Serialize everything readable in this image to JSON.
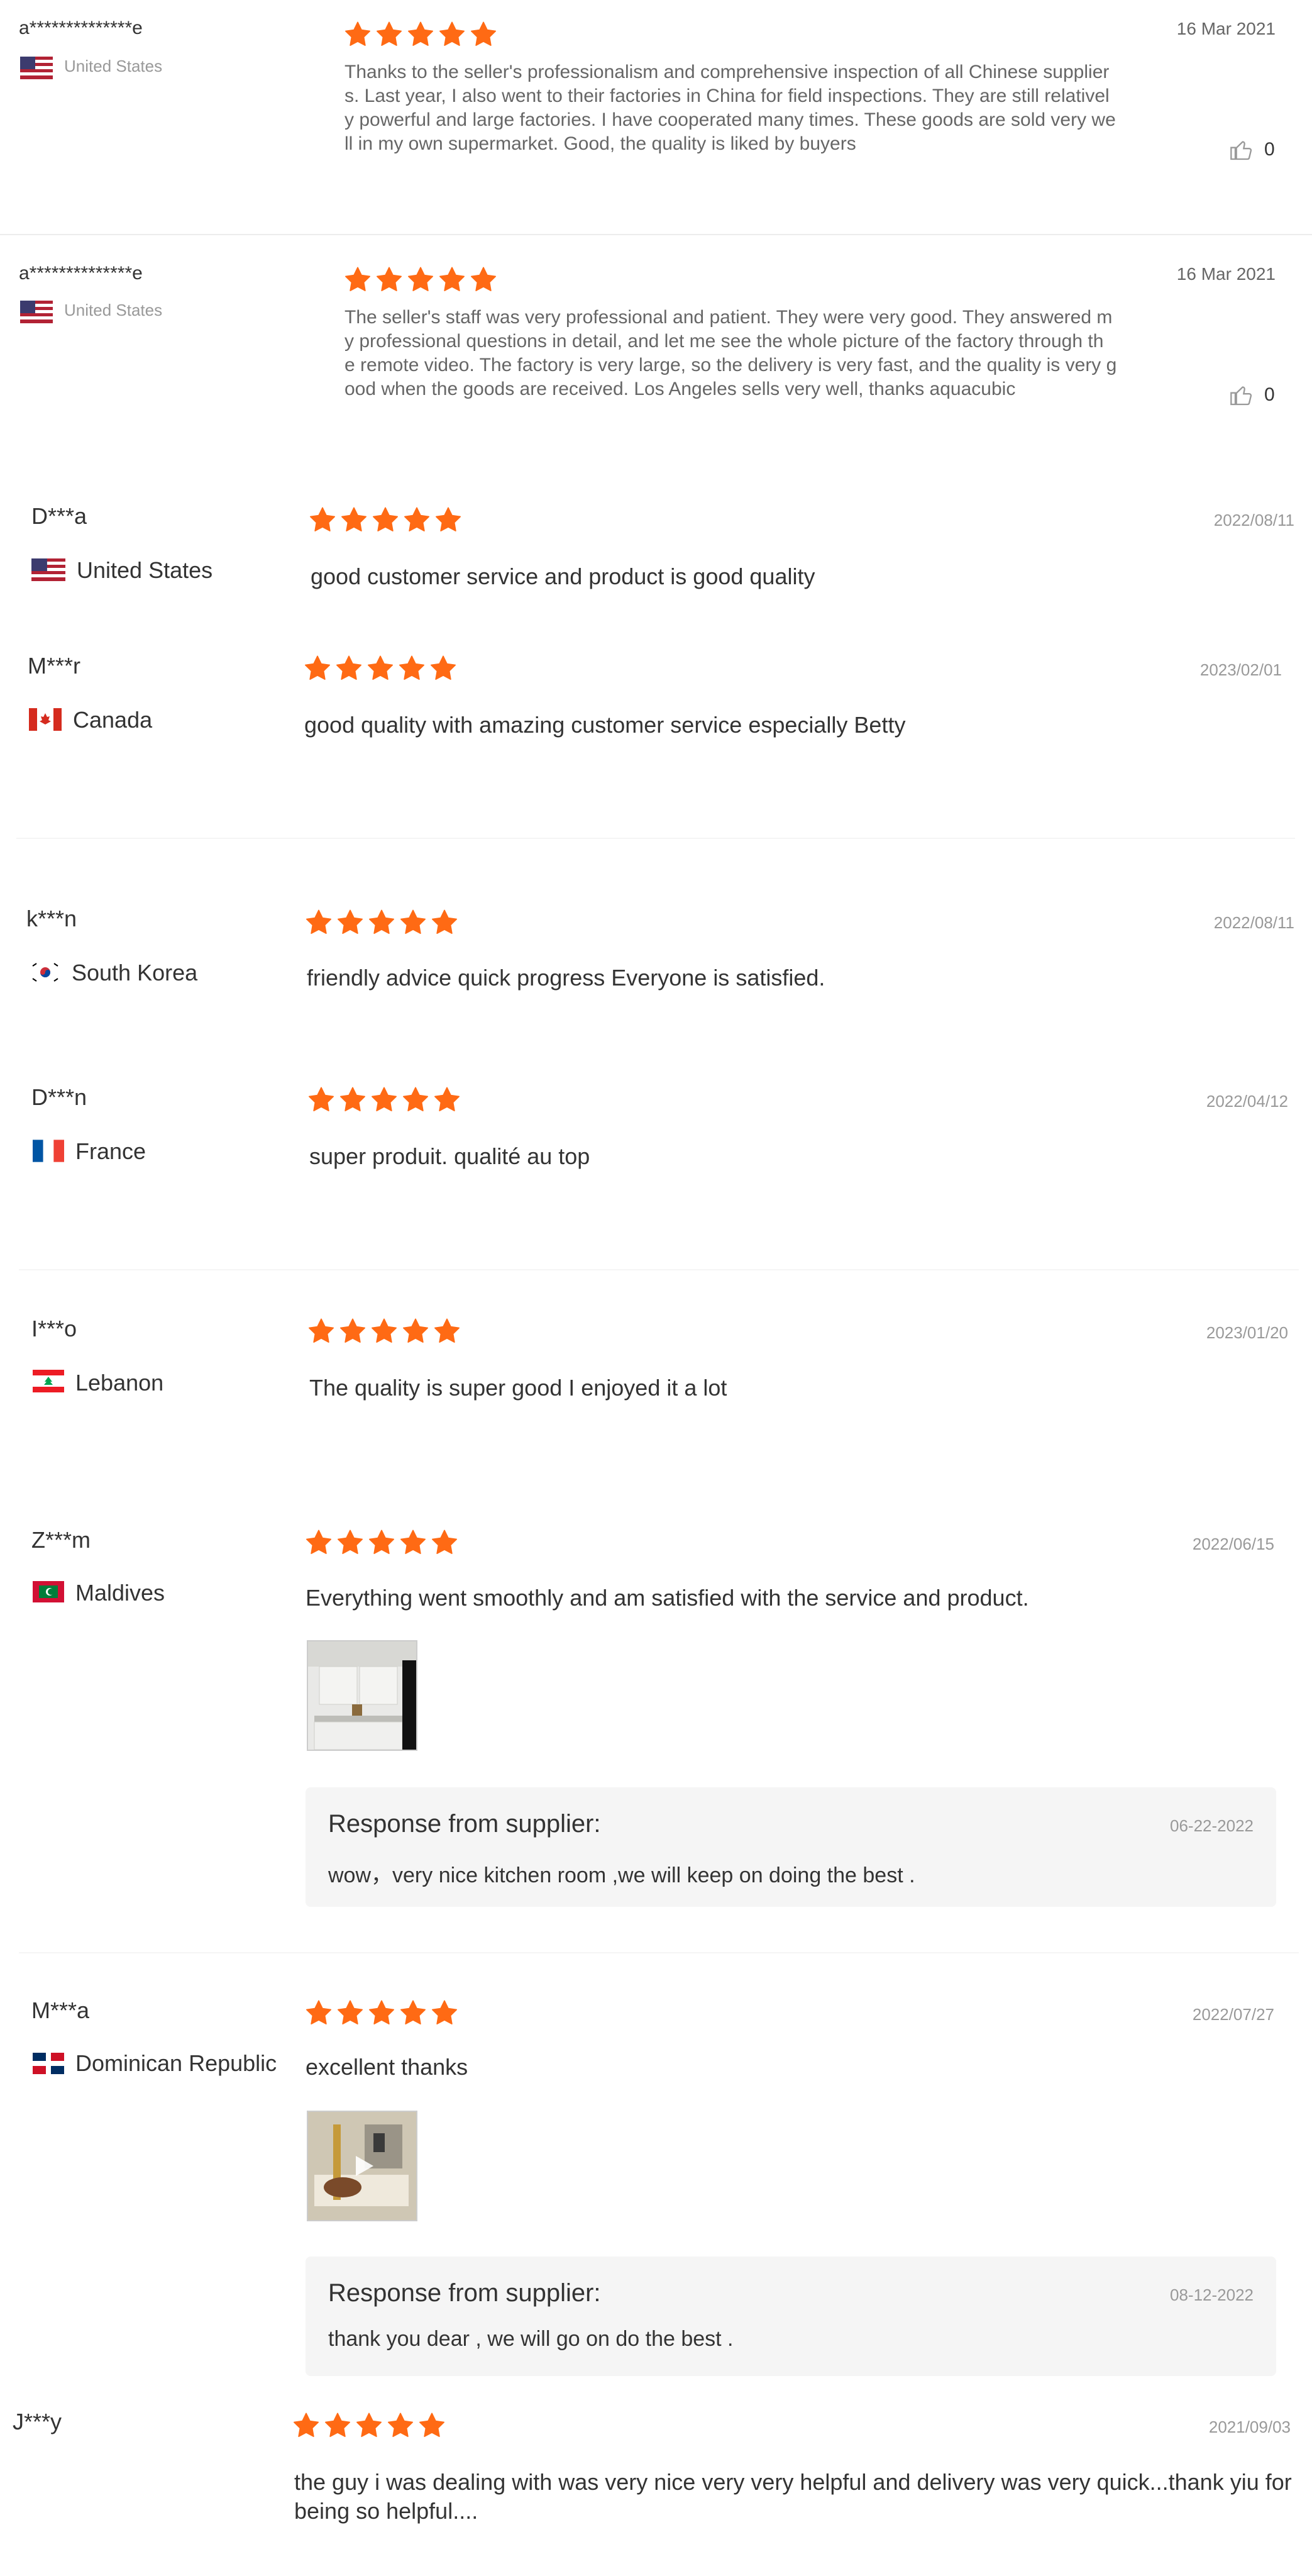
{
  "colors": {
    "star": "#ff6a14",
    "text": "#333333",
    "muted": "#999999",
    "panel": "#f5f5f5"
  },
  "reviews": [
    {
      "name": "a**************e",
      "country": "United States",
      "flag": "us-flag-icon",
      "rating": 5,
      "date": "16 Mar 2021",
      "text": "Thanks to the seller's professionalism and comprehensive inspection of all Chinese supplier\ns. Last year, I also went to their factories in China for field inspections. They are still relativel\ny powerful and large factories. I have cooperated many times. These goods are sold very we\nll in my own supermarket. Good, the quality is liked by buyers",
      "likes": "0"
    },
    {
      "name": "a**************e",
      "country": "United States",
      "flag": "us-flag-icon",
      "rating": 5,
      "date": "16 Mar 2021",
      "text": "The seller's staff was very professional and patient. They were very good. They answered m\ny professional questions in detail, and let me see the whole picture of the factory through th\ne remote video. The factory is very large, so the delivery is very fast, and the quality is very g\nood when the goods are received. Los Angeles sells very well, thanks aquacubic",
      "likes": "0"
    },
    {
      "name": "D***a",
      "country": "United States",
      "flag": "us-flag-icon",
      "rating": 5,
      "date": "2022/08/11",
      "text": "good customer service and product is good quality"
    },
    {
      "name": "M***r",
      "country": "Canada",
      "flag": "canada-flag-icon",
      "rating": 5,
      "date": "2023/02/01",
      "text": "good quality with amazing customer service especially Betty"
    },
    {
      "name": "k***n",
      "country": "South Korea",
      "flag": "south-korea-flag-icon",
      "rating": 5,
      "date": "2022/08/11",
      "text": "friendly advice quick progress Everyone is satisfied."
    },
    {
      "name": "D***n",
      "country": "France",
      "flag": "france-flag-icon",
      "rating": 5,
      "date": "2022/04/12",
      "text": "super produit. qualité au top"
    },
    {
      "name": "I***o",
      "country": "Lebanon",
      "flag": "lebanon-flag-icon",
      "rating": 5,
      "date": "2023/01/20",
      "text": "The quality is super good I enjoyed it a lot"
    },
    {
      "name": "Z***m",
      "country": "Maldives",
      "flag": "maldives-flag-icon",
      "rating": 5,
      "date": "2022/06/15",
      "text": "Everything went smoothly and am satisfied with the service and product.",
      "photo": "kitchen-photo-thumbnail",
      "response": {
        "title": "Response from supplier:",
        "date": "06-22-2022",
        "text": "wow，very nice kitchen room ,we will keep on doing the best ."
      }
    },
    {
      "name": "M***a",
      "country": "Dominican Republic",
      "flag": "dominican-flag-icon",
      "rating": 5,
      "date": "2022/07/27",
      "text": "excellent thanks",
      "photo": "video-thumbnail",
      "response": {
        "title": "Response from supplier:",
        "date": "08-12-2022",
        "text": "thank you dear , we will go on do the best ."
      }
    },
    {
      "name": "J***y",
      "rating": 5,
      "date": "2021/09/03",
      "text": "the guy i was dealing with was very nice very very helpful and delivery was very quick...thank yiu for being so helpful...."
    }
  ]
}
